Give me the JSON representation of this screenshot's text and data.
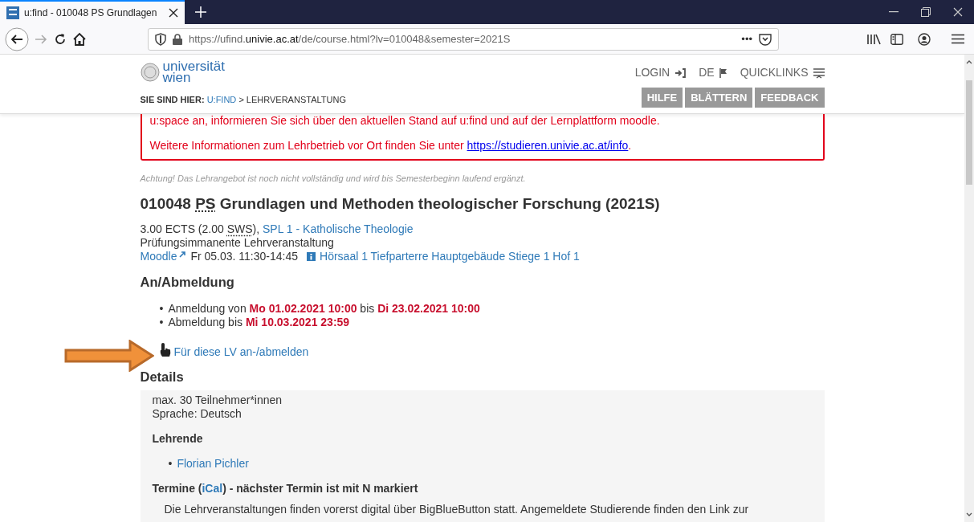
{
  "browser": {
    "tab_title": "u:find - 010048 PS Grundlagen",
    "url": {
      "prefix": "https://ufind.",
      "domain": "univie.ac.at",
      "suffix": "/de/course.html?lv=010048&semester=2021S"
    },
    "page_actions": "•••"
  },
  "header": {
    "logo": {
      "line_1": "universität",
      "line_2": "wien"
    },
    "nav": [
      {
        "label": "LOGIN"
      },
      {
        "label": "DE"
      },
      {
        "label": "QUICKLINKS"
      }
    ],
    "breadcrumb": {
      "label": "SIE SIND HIER:",
      "link": "U:FIND",
      "current": "> LEHRVERANSTALTUNG"
    },
    "buttons": [
      "HILFE",
      "BLÄTTERN",
      "FEEDBACK"
    ]
  },
  "notice": {
    "line_1": "u:space an, informieren Sie sich über den aktuellen Stand auf u:find und auf der Lernplattform moodle.",
    "line_2": "Weitere Informationen zum Lehrbetrieb vor Ort finden Sie unter ",
    "link": "https://studieren.univie.ac.at/info",
    "line_2_end": "."
  },
  "warning": "*Achtung!* Das Lehrangebot ist noch nicht vollständig und wird bis Semesterbeginn laufend ergänzt.",
  "course": {
    "number": "010048",
    "type": "PS",
    "title": "Grundlagen und Methoden theologischer Forschung (2021S)",
    "credits": "3.00 ECTS (2.00 ",
    "hours_abbr": "SWS",
    "credits_end": "), ",
    "program_link": "SPL 1 - Katholische Theologie",
    "assessment": "Prüfungsimmanente Lehrveranstaltung",
    "moodle_link": "Moodle",
    "session": "Fr 05.03. 11:30-14:45",
    "room_link": "Hörsaal 1 Tiefparterre Hauptgebäude Stiege 1 Hof 1"
  },
  "registration": {
    "heading": "An/Abmeldung",
    "bullet": "•",
    "items": [
      [
        {
          "text": "Anmeldung von ",
          "highlight": false
        },
        {
          "text": "Mo 01.02.2021 10:00",
          "highlight": true
        },
        {
          "text": " bis ",
          "highlight": false
        },
        {
          "text": "Di 23.02.2021 10:00",
          "highlight": true
        }
      ],
      [
        {
          "text": "Abmeldung bis ",
          "highlight": false
        },
        {
          "text": "Mi 10.03.2021 23:59",
          "highlight": true
        }
      ]
    ],
    "action_link": "Für diese LV an-/abmelden"
  },
  "details": {
    "heading": "Details",
    "lines": [
      "max. 30 Teilnehmer*innen",
      "Sprache: Deutsch"
    ],
    "teachers_heading": "Lehrende",
    "bullet": "•",
    "teachers": [
      "Florian Pichler"
    ],
    "dates_heading_start": "Termine (",
    "dates_ical": "iCal",
    "dates_heading_end": ") - nächster Termin ist mit N markiert",
    "dates_text": "Die Lehrveranstaltungen finden vorerst digital über BigBlueButton statt. Angemeldete Studierende finden den Link zur"
  }
}
